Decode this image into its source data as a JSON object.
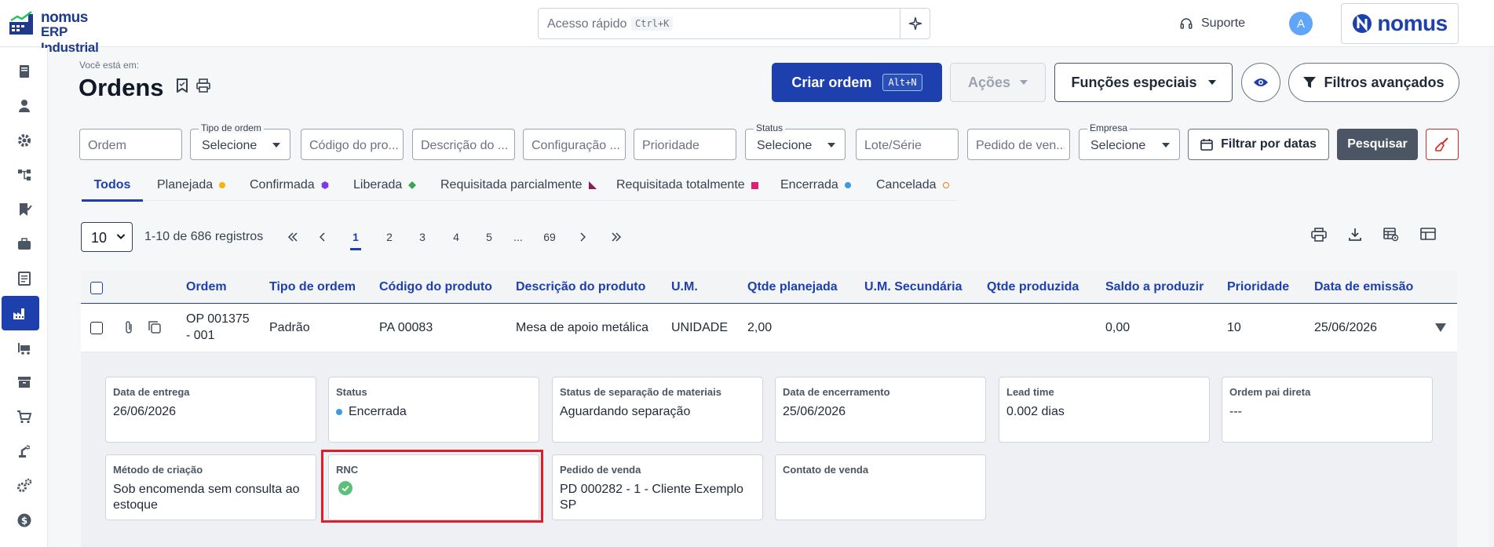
{
  "logo": {
    "line1": "nomus",
    "line2": "ERP Industrial"
  },
  "quick_access": {
    "placeholder": "Acesso rápido",
    "shortcut": "Ctrl+K"
  },
  "header": {
    "support": "Suporte",
    "avatar_initial": "A",
    "brand": "nomus"
  },
  "page": {
    "breadcrumb_label": "Você está em:",
    "title": "Ordens"
  },
  "actions": {
    "create": "Criar ordem",
    "create_shortcut": "Alt+N",
    "actions": "Ações",
    "special": "Funções especiais",
    "advanced_filters": "Filtros avançados"
  },
  "filters": {
    "ordem": "Ordem",
    "tipo_label": "Tipo de ordem",
    "tipo_value": "Selecione",
    "codigo": "Código do pro...",
    "descricao": "Descrição do ...",
    "configuracao": "Configuração ...",
    "prioridade": "Prioridade",
    "status_label": "Status",
    "status_value": "Selecione",
    "lote": "Lote/Série",
    "pedido": "Pedido de ven...",
    "empresa_label": "Empresa",
    "empresa_value": "Selecione",
    "dates": "Filtrar por datas",
    "search": "Pesquisar"
  },
  "tabs": [
    {
      "label": "Todos"
    },
    {
      "label": "Planejada",
      "color": "#f5b400"
    },
    {
      "label": "Confirmada",
      "color": "#7c3aed"
    },
    {
      "label": "Liberada",
      "color": "#34a853"
    },
    {
      "label": "Requisitada parcialmente",
      "color": "#8b1a5a"
    },
    {
      "label": "Requisitada totalmente",
      "color": "#e11d74"
    },
    {
      "label": "Encerrada",
      "color": "#3b9ae1"
    },
    {
      "label": "Cancelada",
      "color": "#f97316"
    }
  ],
  "pagination": {
    "page_size": "10",
    "records": "1-10 de 686 registros",
    "pages": [
      "1",
      "2",
      "3",
      "4",
      "5",
      "...",
      "69"
    ],
    "current": "1"
  },
  "table": {
    "headers": [
      "Ordem",
      "Tipo de ordem",
      "Código do produto",
      "Descrição do produto",
      "U.M.",
      "Qtde planejada",
      "U.M. Secundária",
      "Qtde produzida",
      "Saldo a produzir",
      "Prioridade",
      "Data de emissão"
    ],
    "row": {
      "ordem_line1": "OP 001375",
      "ordem_line2": "- 001",
      "tipo": "Padrão",
      "codigo": "PA 00083",
      "descricao": "Mesa de apoio metálica",
      "um": "UNIDADE",
      "qtde_planejada": "2,00",
      "saldo": "0,00",
      "prioridade": "10",
      "data_emissao": "25/06/2026"
    }
  },
  "details": {
    "data_entrega": {
      "label": "Data de entrega",
      "value": "26/06/2026"
    },
    "status": {
      "label": "Status",
      "value": "Encerrada",
      "dot_color": "#3b9ae1"
    },
    "separacao": {
      "label": "Status de separação de materiais",
      "value": "Aguardando separação"
    },
    "encerramento": {
      "label": "Data de encerramento",
      "value": "25/06/2026"
    },
    "lead_time": {
      "label": "Lead time",
      "value": "0.002 dias"
    },
    "ordem_pai": {
      "label": "Ordem pai direta",
      "value": "---"
    },
    "metodo": {
      "label": "Método de criação",
      "value": "Sob encomenda sem consulta ao estoque"
    },
    "rnc": {
      "label": "RNC",
      "icon": "check-circle-icon"
    },
    "pedido_venda": {
      "label": "Pedido de venda",
      "value": "PD 000282 - 1 - Cliente Exemplo SP"
    },
    "contato": {
      "label": "Contato de venda",
      "value": ""
    }
  }
}
